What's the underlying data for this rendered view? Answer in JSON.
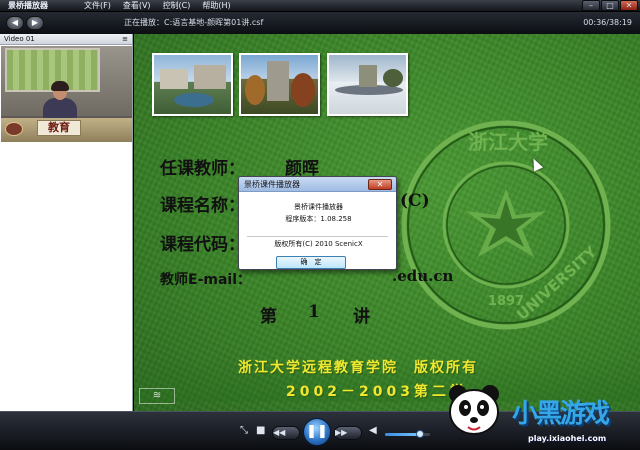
{
  "titlebar": {
    "app_title": "景桥播放器"
  },
  "menu": {
    "items": [
      {
        "label": "文件(F)"
      },
      {
        "label": "查看(V)"
      },
      {
        "label": "控制(C)"
      },
      {
        "label": "帮助(H)"
      }
    ]
  },
  "nav": {
    "now_playing": "正在播放：C:语言基地-颜晖第01讲.csf",
    "time": "00:36/38:19"
  },
  "video_panel": {
    "title": "Video 01",
    "sign_text": "教育"
  },
  "slide": {
    "teacher_label": "任课教师：",
    "teacher_name": "颜晖",
    "course_name_label": "课程名称：",
    "course_code_label": "课程代码：",
    "copyright_c": "(C)",
    "email_label": "教师E-mail：",
    "email_domain": ".edu.cn",
    "lecture_prefix": "第",
    "lecture_number": "1",
    "lecture_suffix": "讲",
    "school_line": "浙江大学远程教育学院　版权所有",
    "year_line": "2002－2003第二学",
    "emblem_year": "1897",
    "emblem_university": "UNIVERSITY",
    "emblem_top_text": "浙江大学"
  },
  "dialog": {
    "title": "景桥课件播放器",
    "app_name": "景桥课件播放器",
    "version": "程序版本：1.08.258",
    "copyright": "版权所有(C) 2010 ScenicX",
    "ok_label": "确　定"
  },
  "controls": {
    "play_state": "pause",
    "volume_fraction": 0.78
  },
  "watermark": {
    "brand": "小黑游戏",
    "url": "play.ixiaohei.com"
  },
  "colors": {
    "slide_green": "#3a8427",
    "slide_yellow_text": "#f0e830",
    "play_button_blue": "#2d74c6"
  }
}
